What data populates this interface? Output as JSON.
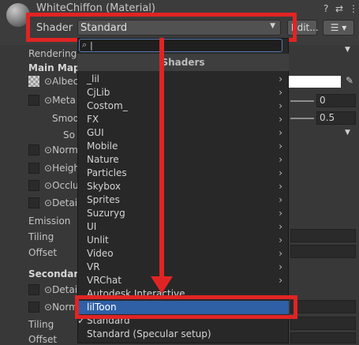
{
  "header": {
    "title": "WhiteChiffon (Material)",
    "shader_label": "Shader",
    "shader_value": "Standard",
    "edit_label": "Edit...",
    "help_icon": "?",
    "settings_icon": "⇄",
    "more_icon": "⋮"
  },
  "inspector": {
    "rendering": "Rendering",
    "main_maps": "Main Maps",
    "albedo": "Albec",
    "metallic": "Meta",
    "smoothness": "Smod",
    "source": "So",
    "normal": "Norm",
    "height": "Heigh",
    "occlusion": "Occlu",
    "detail": "Detai",
    "emission": "Emission",
    "tiling": "Tiling",
    "offset": "Offset",
    "secondary": "Secondary",
    "detail2": "Detai",
    "normal2": "Norm",
    "tiling2": "Tiling",
    "offset2": "Offset",
    "metallic_value": "0",
    "smoothness_value": "0.5"
  },
  "menu": {
    "search_placeholder": "",
    "header": "Shaders",
    "items": [
      {
        "label": "_lil",
        "submenu": true
      },
      {
        "label": "CjLib",
        "submenu": true
      },
      {
        "label": "Costom_",
        "submenu": true
      },
      {
        "label": "FX",
        "submenu": true
      },
      {
        "label": "GUI",
        "submenu": true
      },
      {
        "label": "Mobile",
        "submenu": true
      },
      {
        "label": "Nature",
        "submenu": true
      },
      {
        "label": "Particles",
        "submenu": true
      },
      {
        "label": "Skybox",
        "submenu": true
      },
      {
        "label": "Sprites",
        "submenu": true
      },
      {
        "label": "Suzuryg",
        "submenu": true
      },
      {
        "label": "UI",
        "submenu": true
      },
      {
        "label": "Unlit",
        "submenu": true
      },
      {
        "label": "Video",
        "submenu": true
      },
      {
        "label": "VR",
        "submenu": true
      },
      {
        "label": "VRChat",
        "submenu": true
      },
      {
        "label": "Autodesk Interactive",
        "submenu": false
      },
      {
        "label": "lilToon",
        "submenu": false,
        "selected": true
      },
      {
        "label": "Standard",
        "submenu": false,
        "checked": true
      },
      {
        "label": "Standard (Specular setup)",
        "submenu": false
      }
    ]
  },
  "colors": {
    "annotation_red": "#e02424",
    "selection_blue": "#2f5fa5",
    "background": "#383838"
  }
}
